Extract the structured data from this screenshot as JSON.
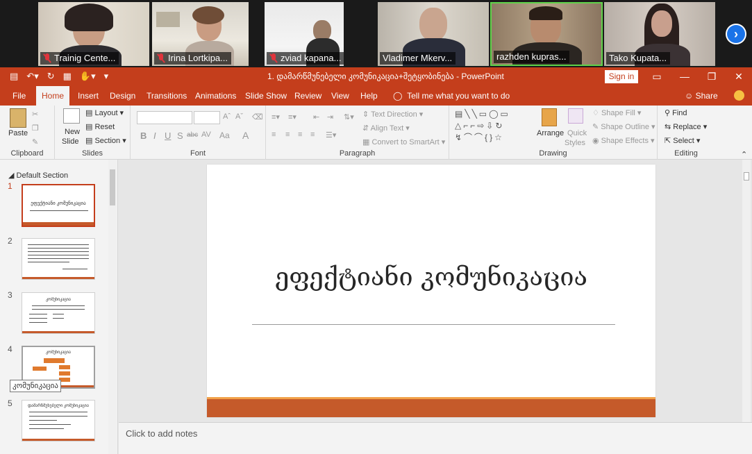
{
  "participants": [
    {
      "name": "Trainig Cente..."
    },
    {
      "name": "Irina Lortkipa..."
    },
    {
      "name": "zviad kapana..."
    },
    {
      "name": "Vladimer Mkerv..."
    },
    {
      "name": "razhden kupras..."
    },
    {
      "name": "Tako Kupata..."
    }
  ],
  "gallery": {
    "next_arrow": "›"
  },
  "titlebar": {
    "title": "1. დამარწმუნებელი კომუნიკაცია+შეტყობინება  -  PowerPoint",
    "signin": "Sign in"
  },
  "tabs": [
    "File",
    "Home",
    "Insert",
    "Design",
    "Transitions",
    "Animations",
    "Slide Show",
    "Review",
    "View",
    "Help"
  ],
  "tell_me": "Tell me what you want to do",
  "share": "Share",
  "ribbon": {
    "clipboard": {
      "paste": "Paste",
      "label": "Clipboard"
    },
    "slides": {
      "new_slide_1": "New",
      "new_slide_2": "Slide",
      "layout": "Layout",
      "reset": "Reset",
      "section": "Section",
      "label": "Slides"
    },
    "font": {
      "label": "Font",
      "bold": "B",
      "italic": "I",
      "underline": "U",
      "shadow": "S",
      "strike": "abc",
      "spacing": "AV",
      "case": "Aa",
      "color": "A"
    },
    "paragraph": {
      "label": "Paragraph",
      "text_direction": "Text Direction",
      "align_text": "Align Text",
      "smartart": "Convert to SmartArt"
    },
    "drawing": {
      "label": "Drawing",
      "arrange": "Arrange",
      "quick_1": "Quick",
      "quick_2": "Styles",
      "shape_fill": "Shape Fill",
      "shape_outline": "Shape Outline",
      "shape_effects": "Shape Effects"
    },
    "editing": {
      "label": "Editing",
      "find": "Find",
      "replace": "Replace",
      "select": "Select"
    }
  },
  "thumbnails": {
    "section": "Default Section",
    "slides": [
      {
        "num": "1",
        "title": "ეფექტიანი კომუნიკაცია"
      },
      {
        "num": "2",
        "title": ""
      },
      {
        "num": "3",
        "title": "კომუნიკაცია"
      },
      {
        "num": "4",
        "title": "კომუნიკაცია"
      },
      {
        "num": "5",
        "title": "დამარწმუნებელი კომუნიკაცია"
      }
    ],
    "tooltip": "კომუნიკაცია"
  },
  "slide": {
    "title": "ეფექტიანი კომუნიკაცია"
  },
  "notes": {
    "placeholder": "Click to add notes"
  },
  "colors": {
    "accent": "#c43e1c",
    "slide_bar": "#c55a2a"
  }
}
